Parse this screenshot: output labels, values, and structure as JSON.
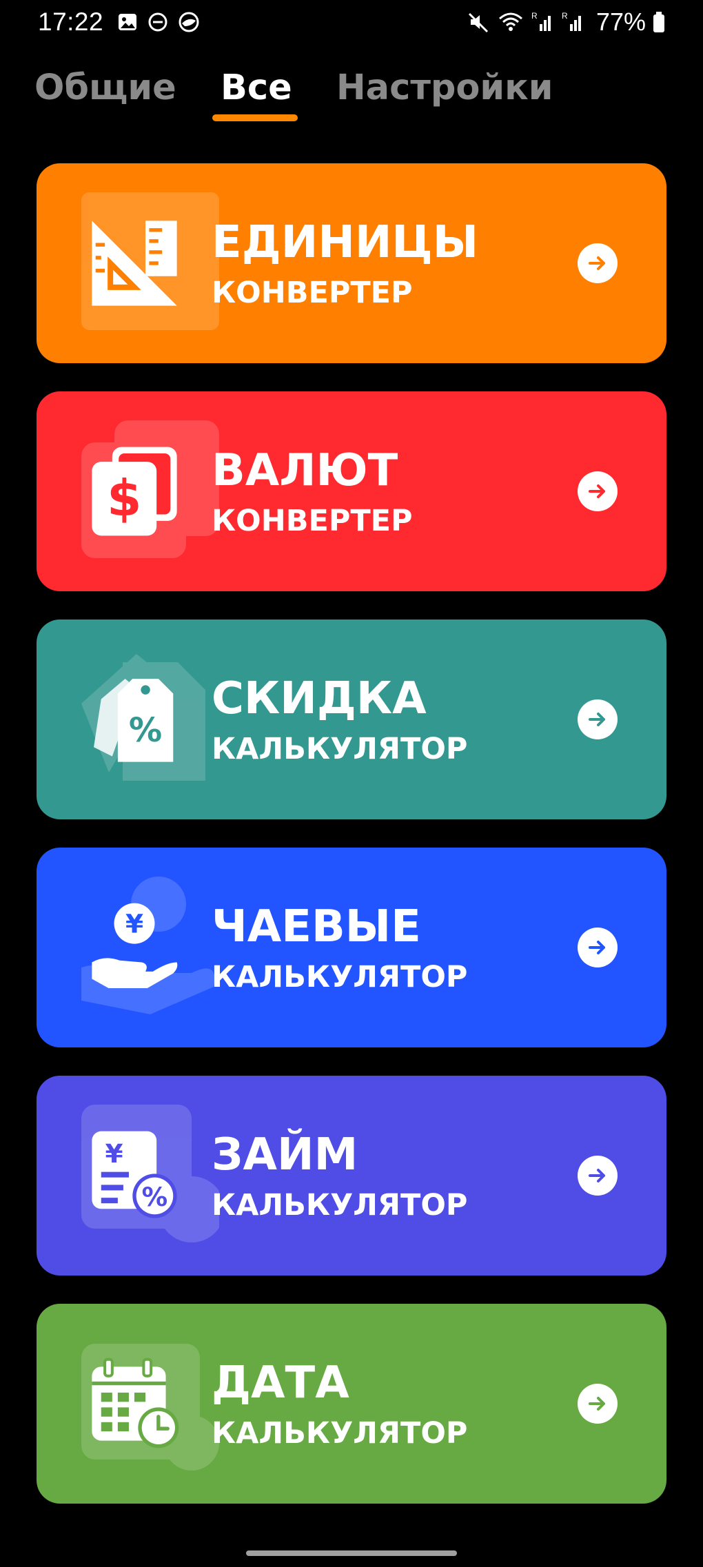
{
  "status_bar": {
    "time": "17:22",
    "battery": "77%",
    "icons_left": [
      "image-icon",
      "dnd-icon",
      "shield-icon"
    ],
    "icons_right": [
      "mute-icon",
      "wifi-icon",
      "signal-icon",
      "signal-icon",
      "battery-icon"
    ]
  },
  "tabs": [
    {
      "label": "Общие",
      "active": false
    },
    {
      "label": "Все",
      "active": true
    },
    {
      "label": "Настройки",
      "active": false
    }
  ],
  "accent_color": "#ff8800",
  "cards": [
    {
      "title": "ЕДИНИЦЫ",
      "subtitle": "КОНВЕРТЕР",
      "icon": "ruler-triangle-icon",
      "color": "#ff7f00"
    },
    {
      "title": "ВАЛЮТ",
      "subtitle": "КОНВЕРТЕР",
      "icon": "dollar-bill-icon",
      "color": "#ff2a2f"
    },
    {
      "title": "СКИДКА",
      "subtitle": "КАЛЬКУЛЯТОР",
      "icon": "percent-tag-icon",
      "color": "#33988f"
    },
    {
      "title": "ЧАЕВЫЕ",
      "subtitle": "КАЛЬКУЛЯТОР",
      "icon": "yen-hand-icon",
      "color": "#2255ff"
    },
    {
      "title": "ЗАЙМ",
      "subtitle": "КАЛЬКУЛЯТОР",
      "icon": "loan-percent-icon",
      "color": "#4f4de6"
    },
    {
      "title": "ДАТА",
      "subtitle": "КАЛЬКУЛЯТОР",
      "icon": "calendar-clock-icon",
      "color": "#67a942"
    }
  ]
}
